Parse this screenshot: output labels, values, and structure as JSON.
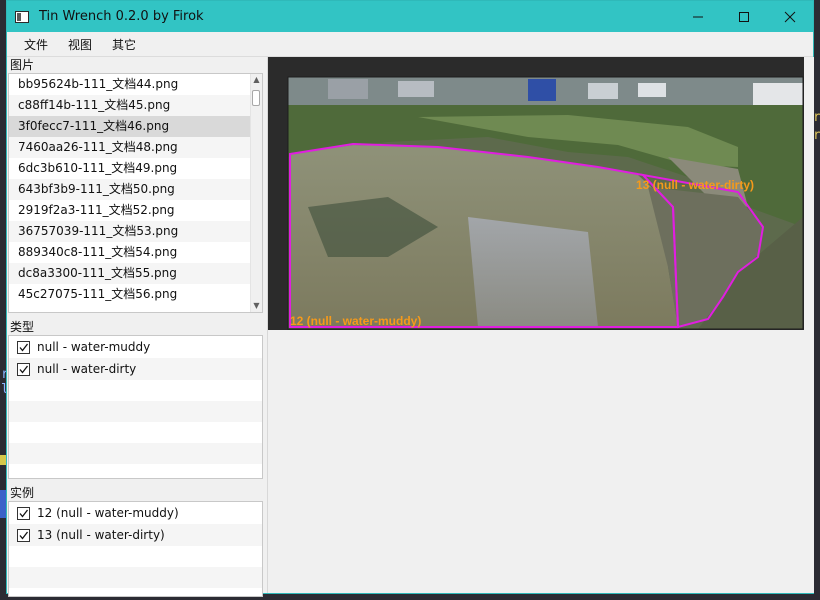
{
  "window": {
    "title": "Tin Wrench 0.2.0 by Firok"
  },
  "menu": [
    "文件",
    "视图",
    "其它"
  ],
  "images": {
    "label": "图片",
    "items": [
      "bb95624b-111_文档44.png",
      "c88ff14b-111_文档45.png",
      "3f0fecc7-111_文档46.png",
      "7460aa26-111_文档48.png",
      "6dc3b610-111_文档49.png",
      "643bf3b9-111_文档50.png",
      "2919f2a3-111_文档52.png",
      "36757039-111_文档53.png",
      "889340c8-111_文档54.png",
      "dc8a3300-111_文档55.png",
      "45c27075-111_文档56.png"
    ],
    "selected_index": 2
  },
  "types": {
    "label": "类型",
    "items": [
      {
        "label": "null - water-muddy",
        "checked": true
      },
      {
        "label": "null - water-dirty",
        "checked": true
      }
    ]
  },
  "instances": {
    "label": "实例",
    "items": [
      {
        "label": "12 (null - water-muddy)",
        "checked": true
      },
      {
        "label": "13 (null - water-dirty)",
        "checked": true
      }
    ]
  },
  "annotations": [
    {
      "label": "12 (null - water-muddy)"
    },
    {
      "label": "13 (null - water-dirty)"
    }
  ],
  "colors": {
    "titlebar": "#32c4c4",
    "annotation_outline": "#e01ee0",
    "annotation_label": "#f59a1b"
  }
}
